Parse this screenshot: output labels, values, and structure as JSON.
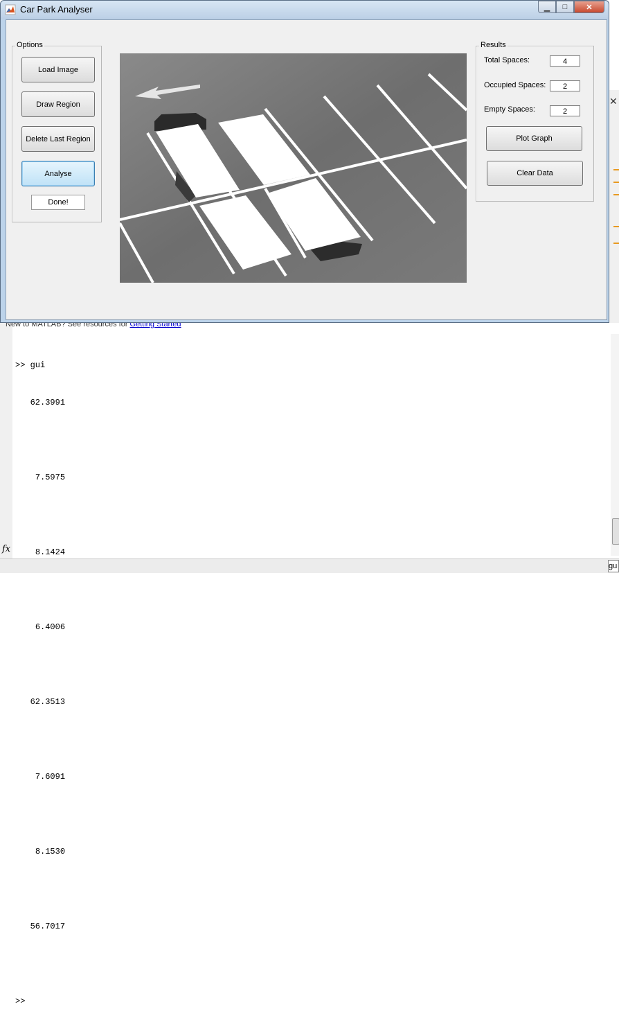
{
  "window": {
    "title": "Car Park Analyser"
  },
  "options_panel": {
    "title": "Options",
    "buttons": [
      "Load Image",
      "Draw Region",
      "Delete Last Region",
      "Analyse",
      "Done!"
    ]
  },
  "results_panel": {
    "title": "Results",
    "fields": [
      {
        "label": "Total Spaces:",
        "value": "4"
      },
      {
        "label": "Occupied Spaces:",
        "value": "2"
      },
      {
        "label": "Empty Spaces:",
        "value": "2"
      }
    ],
    "plot_button": "Plot Graph",
    "clear_button": "Clear Data"
  },
  "command_window": {
    "hint_prefix": "New to MATLAB? See resources for",
    "hint_link": "Getting Started",
    "prompt_command": ">> gui",
    "outputs": [
      "62.3991",
      "7.5975",
      "8.1424",
      "6.4006",
      "62.3513",
      "7.6091",
      "8.1530",
      "56.7017"
    ],
    "prompt": ">>",
    "fx_icon": "fx"
  },
  "status_bar": {
    "text": "gu"
  },
  "colors": {
    "title_bar": "#bcd0e6",
    "active_button": "#bfe2f7",
    "close_button": "#c84a30"
  }
}
